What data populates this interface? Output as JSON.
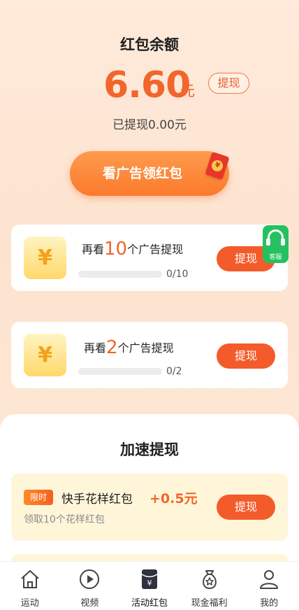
{
  "balance": {
    "title": "红包余额",
    "amount": "6.60",
    "unit": "元",
    "withdraw_label": "提现",
    "withdrawn_text": "已提现0.00元"
  },
  "cta": {
    "label": "看广告领红包",
    "envelope_glyph": "¥"
  },
  "tasks": [
    {
      "prefix": "再看",
      "count": "10",
      "suffix": "个广告提现",
      "progress_text": "0/10",
      "progress": 0,
      "button": "提现",
      "icon_glyph": "¥"
    },
    {
      "prefix": "再看",
      "count": "2",
      "suffix": "个广告提现",
      "progress_text": "0/2",
      "progress": 0,
      "button": "提现",
      "icon_glyph": "¥"
    }
  ],
  "service": {
    "label": "客服"
  },
  "fast": {
    "title": "加速提现",
    "items": [
      {
        "badge": "限时",
        "name": "快手花样红包",
        "bonus": "+0.5元",
        "desc": "领取10个花样红包",
        "button": "提现"
      }
    ]
  },
  "tabbar": {
    "items": [
      {
        "label": "运动",
        "icon": "home-icon"
      },
      {
        "label": "视频",
        "icon": "play-icon"
      },
      {
        "label": "活动红包",
        "icon": "red-packet-icon",
        "glyph": "¥",
        "active": true
      },
      {
        "label": "现金福利",
        "icon": "money-bag-icon"
      },
      {
        "label": "我的",
        "icon": "user-icon"
      }
    ]
  },
  "colors": {
    "accent": "#f2652b",
    "button": "#f45b2a",
    "service": "#25c15f",
    "fast_card_bg": "#fff6da"
  }
}
